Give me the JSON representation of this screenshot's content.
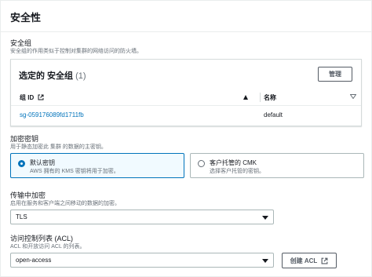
{
  "section": {
    "title": "安全性"
  },
  "security_group": {
    "label": "安全组",
    "description": "安全组的作用类似于控制对集群的网络访问的防火墙。",
    "table_title": "选定的 安全组",
    "count": "(1)",
    "manage_label": "管理",
    "columns": [
      "组 ID",
      "名称"
    ],
    "rows": [
      {
        "id": "sg-059176089fd1711fb",
        "name": "default"
      }
    ]
  },
  "encryption": {
    "label": "加密密钥",
    "description": "用于静态加密此 集群 的数据的主密钥。",
    "options": [
      {
        "title": "默认密钥",
        "desc": "AWS 拥有的 KMS 密钥将用于加密。",
        "selected": true
      },
      {
        "title": "客户托管的 CMK",
        "desc": "选择客户托管的密钥。",
        "selected": false
      }
    ]
  },
  "transit": {
    "label": "传输中加密",
    "description": "启用在服务和客户端之间移动的数据的加密。",
    "value": "TLS"
  },
  "acl": {
    "label": "访问控制列表 (ACL)",
    "description": "ACL 和开放访问 ACL 的列表。",
    "value": "open-access",
    "create_label": "创建 ACL"
  },
  "colors": {
    "accent": "#0073bb",
    "border": "#aab7b8",
    "text": "#16191f",
    "muted": "#687078"
  }
}
